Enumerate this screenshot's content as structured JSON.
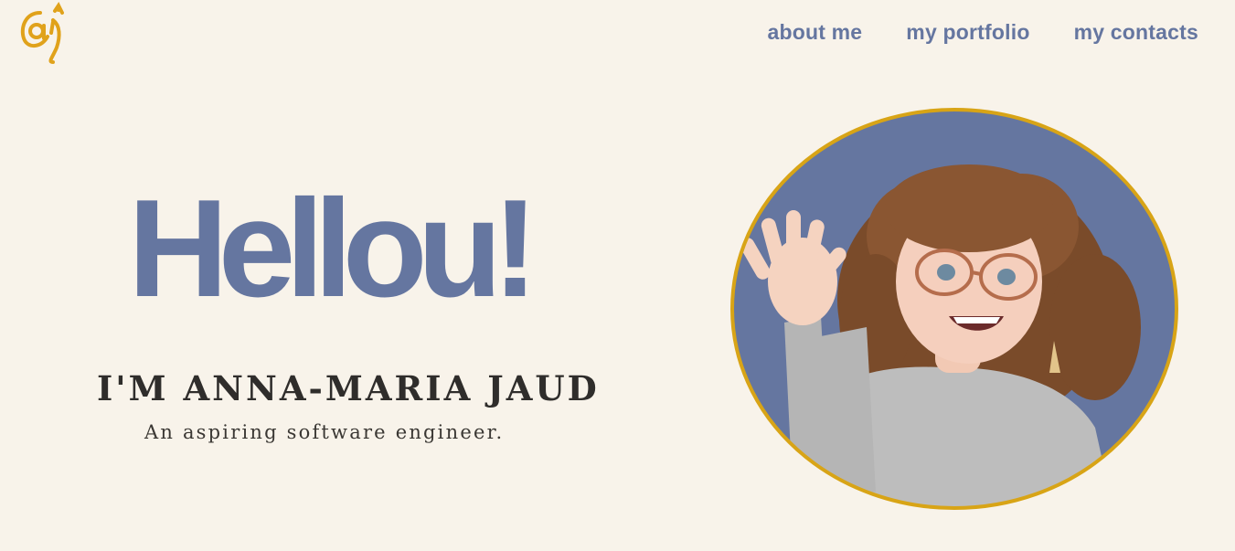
{
  "header": {
    "logo_alt": "aj",
    "nav": [
      {
        "label": "about me"
      },
      {
        "label": "my portfolio"
      },
      {
        "label": "my contacts"
      }
    ]
  },
  "hero": {
    "title": "Hellou!",
    "name": "I'M ANNA-MARIA JAUD",
    "tagline": "An aspiring software engineer."
  },
  "colors": {
    "background": "#f8f3ea",
    "accent": "#6576a0",
    "logo": "#e0a21b",
    "avatar_border": "#d8a416",
    "text_dark": "#2f2d2b"
  },
  "icons": {
    "logo": "aj-monogram-logo",
    "avatar": "waving-memoji-avatar"
  }
}
